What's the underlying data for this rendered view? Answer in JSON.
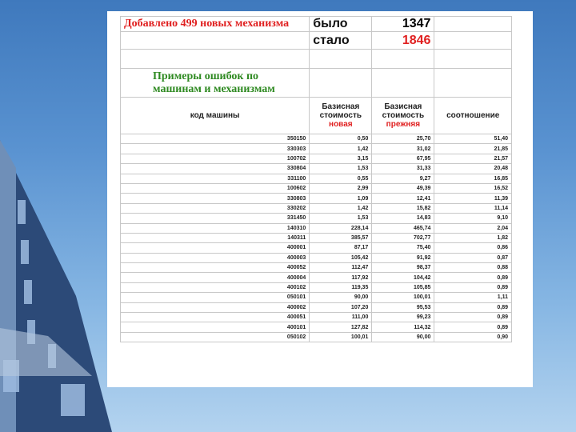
{
  "header": {
    "added_label": "Добавлено 499 новых механизма",
    "before_label": "было",
    "before_value": "1347",
    "after_label": "стало",
    "after_value": "1846",
    "examples_title": "Примеры ошибок по машинам и механизмам"
  },
  "columns": {
    "code": "код машины",
    "new_cost_line1": "Базисная",
    "new_cost_line2": "стоимость",
    "new_cost_line3": "новая",
    "old_cost_line1": "Базисная",
    "old_cost_line2": "стоимость",
    "old_cost_line3": "прежняя",
    "ratio": "соотношение"
  },
  "rows": [
    {
      "code": "350150",
      "new": "0,50",
      "old": "25,70",
      "ratio": "51,40"
    },
    {
      "code": "330303",
      "new": "1,42",
      "old": "31,02",
      "ratio": "21,85"
    },
    {
      "code": "100702",
      "new": "3,15",
      "old": "67,95",
      "ratio": "21,57"
    },
    {
      "code": "330804",
      "new": "1,53",
      "old": "31,33",
      "ratio": "20,48"
    },
    {
      "code": "331100",
      "new": "0,55",
      "old": "9,27",
      "ratio": "16,85"
    },
    {
      "code": "100602",
      "new": "2,99",
      "old": "49,39",
      "ratio": "16,52"
    },
    {
      "code": "330803",
      "new": "1,09",
      "old": "12,41",
      "ratio": "11,39"
    },
    {
      "code": "330202",
      "new": "1,42",
      "old": "15,82",
      "ratio": "11,14"
    },
    {
      "code": "331450",
      "new": "1,53",
      "old": "14,83",
      "ratio": "9,10"
    },
    {
      "code": "140310",
      "new": "228,14",
      "old": "465,74",
      "ratio": "2,04"
    },
    {
      "code": "140311",
      "new": "385,57",
      "old": "702,77",
      "ratio": "1,82"
    },
    {
      "code": "400001",
      "new": "87,17",
      "old": "75,40",
      "ratio": "0,86"
    },
    {
      "code": "400003",
      "new": "105,42",
      "old": "91,92",
      "ratio": "0,87"
    },
    {
      "code": "400052",
      "new": "112,47",
      "old": "98,37",
      "ratio": "0,88"
    },
    {
      "code": "400004",
      "new": "117,92",
      "old": "104,42",
      "ratio": "0,89"
    },
    {
      "code": "400102",
      "new": "119,35",
      "old": "105,85",
      "ratio": "0,89"
    },
    {
      "code": "050101",
      "new": "90,00",
      "old": "100,01",
      "ratio": "1,11"
    },
    {
      "code": "400002",
      "new": "107,20",
      "old": "95,53",
      "ratio": "0,89"
    },
    {
      "code": "400051",
      "new": "111,00",
      "old": "99,23",
      "ratio": "0,89"
    },
    {
      "code": "400101",
      "new": "127,82",
      "old": "114,32",
      "ratio": "0,89"
    },
    {
      "code": "050102",
      "new": "100,01",
      "old": "90,00",
      "ratio": "0,90"
    }
  ]
}
